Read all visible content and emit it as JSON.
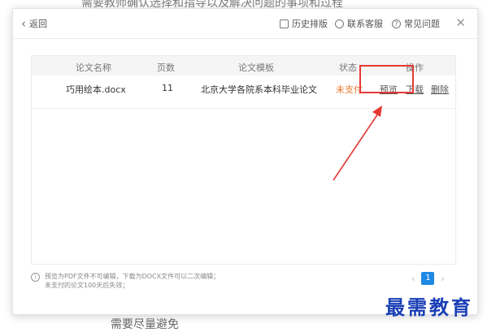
{
  "background": {
    "top_text": "需要教师确认选择和指导以及解决问题的事项和过程",
    "bottom_text": "需要尽量避免"
  },
  "topbar": {
    "back_label": "返回",
    "history_label": "历史排版",
    "support_label": "联系客服",
    "faq_label": "常见问题"
  },
  "table": {
    "headers": [
      "论文名称",
      "页数",
      "论文模板",
      "状态",
      "操作"
    ],
    "rows": [
      {
        "name": "巧用绘本.docx",
        "pages": "11",
        "template": "北京大学各院系本科毕业论文",
        "status": "未支付",
        "actions": {
          "preview": "预览",
          "download": "下载",
          "delete": "删除"
        }
      }
    ]
  },
  "footer": {
    "note_line1": "预览为PDF文件不可编辑，下载为DOCX文件可以二次编辑；",
    "note_line2": "未支付的论文100天后失效；"
  },
  "pagination": {
    "current": "1",
    "prev": "‹",
    "next": "›"
  },
  "watermark": "最需教育",
  "colors": {
    "status_unpaid": "#e8762d",
    "highlight": "#e53935",
    "accent": "#1e88e5",
    "watermark": "#1a3fb5"
  }
}
